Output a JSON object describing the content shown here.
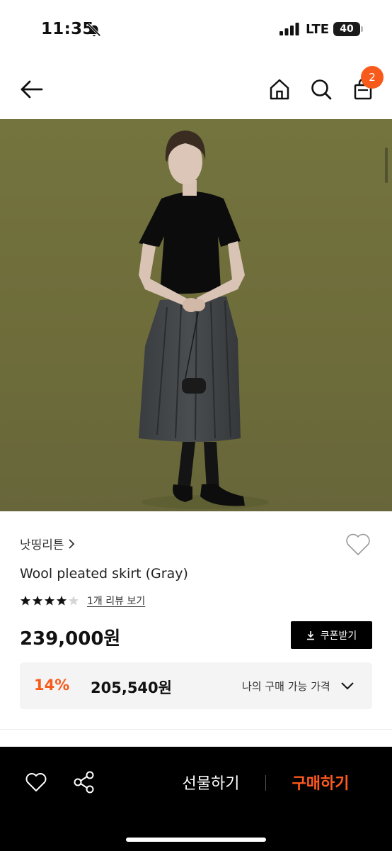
{
  "status": {
    "time": "11:35",
    "network": "LTE",
    "battery": "40"
  },
  "nav": {
    "cart_count": "2"
  },
  "product": {
    "brand": "낫띵리튼",
    "name": "Wool pleated skirt (Gray)",
    "rating": 4,
    "review_link": "1개 리뷰 보기",
    "price": "239,000원",
    "coupon_label": "쿠폰받기",
    "discount": "14%",
    "sale_price": "205,540원",
    "my_price_label": "나의 구매 가능 가격"
  },
  "bottom": {
    "gift_label": "선물하기",
    "buy_label": "구매하기"
  },
  "colors": {
    "accent": "#f75a1a",
    "buy": "#ff5a1f",
    "image_bg": "#6f6f3c"
  },
  "icons": [
    "bell-slash-icon",
    "signal-icon",
    "battery-icon",
    "arrow-left-icon",
    "home-icon",
    "search-icon",
    "shopping-bag-icon",
    "heart-icon",
    "star-icon",
    "download-icon",
    "chevron-down-icon",
    "share-icon"
  ]
}
